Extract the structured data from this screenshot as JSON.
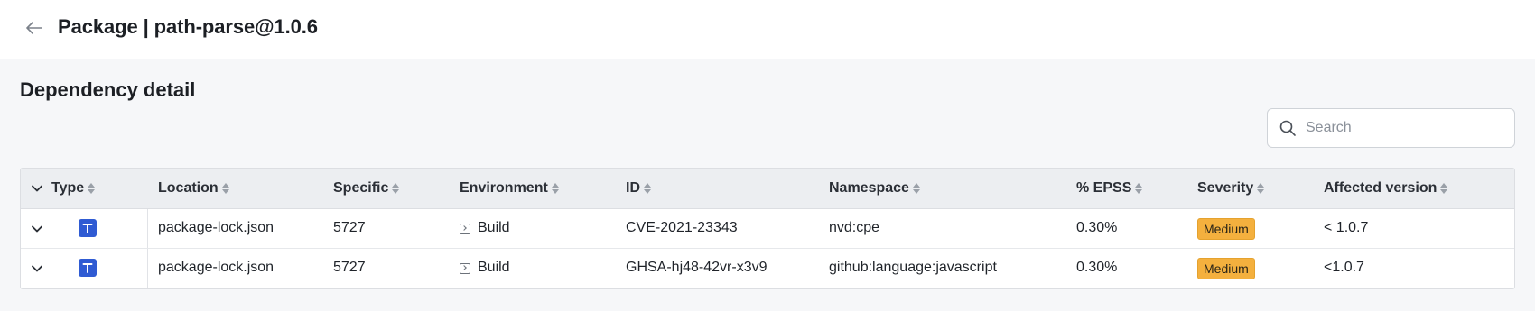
{
  "header": {
    "title": "Package | path-parse@1.0.6"
  },
  "section": {
    "title": "Dependency detail"
  },
  "search": {
    "placeholder": "Search",
    "value": ""
  },
  "table": {
    "columns": [
      "Type",
      "Location",
      "Specific",
      "Environment",
      "ID",
      "Namespace",
      "% EPSS",
      "Severity",
      "Affected version"
    ],
    "rows": [
      {
        "type_icon": "package-type-icon",
        "location": "package-lock.json",
        "specific": "5727",
        "environment": "Build",
        "id": "CVE-2021-23343",
        "namespace": "nvd:cpe",
        "epss": "0.30%",
        "severity": "Medium",
        "affected_version": "< 1.0.7"
      },
      {
        "type_icon": "package-type-icon",
        "location": "package-lock.json",
        "specific": "5727",
        "environment": "Build",
        "id": "GHSA-hj48-42vr-x3v9",
        "namespace": "github:language:javascript",
        "epss": "0.30%",
        "severity": "Medium",
        "affected_version": "<1.0.7"
      }
    ]
  },
  "colors": {
    "severity_medium": "#f4b03e",
    "type_icon": "#2f5bd3",
    "header_bg": "#eceef1"
  }
}
